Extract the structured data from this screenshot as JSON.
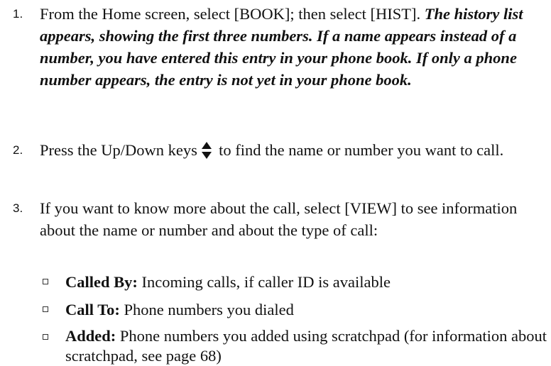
{
  "steps": [
    {
      "number": "1.",
      "text": "From the Home screen, select [BOOK]; then select [HIST]. ",
      "note": "The history list appears, showing the first three numbers. If a name appears instead of a number, you have entered this entry in your phone book. If only a phone number appears, the entry is not yet in your phone book."
    },
    {
      "number": "2.",
      "text_before_icon": "Press the Up/Down keys ",
      "icon": "up-down-arrow-icon",
      "text_after_icon": " to find the name or number you want to call."
    },
    {
      "number": "3.",
      "text": "If you want to know more about the call, select [VIEW] to see information about the name or number and about the type of call:"
    }
  ],
  "bullets": [
    {
      "term": "Called By:",
      "text": " Incoming calls, if caller ID is available"
    },
    {
      "term": "Call To:",
      "text": " Phone numbers you dialed"
    },
    {
      "term": "Added:",
      "text": " Phone numbers you added using scratchpad (for information about scratchpad, see page 68)"
    }
  ]
}
